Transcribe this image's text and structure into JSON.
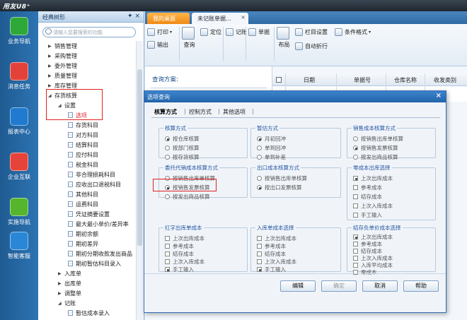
{
  "titlebar": {
    "logo": "用友U8⁺"
  },
  "iconbar": [
    {
      "label": "业务导航",
      "color": "#2fa83a"
    },
    {
      "label": "消息任务",
      "color": "#e3423a"
    },
    {
      "label": "报表中心",
      "color": "#1f7ad0"
    },
    {
      "label": "企业互联",
      "color": "#e6443a"
    },
    {
      "label": "实施导航",
      "color": "#55b52c"
    },
    {
      "label": "智能客服",
      "color": "#2a86d6"
    }
  ],
  "tree_panel": {
    "title": "经典树形",
    "pins": "✦ ×",
    "search_placeholder": "请输入您要搜索的功能",
    "items": [
      {
        "label": "销售管理"
      },
      {
        "label": "采购管理"
      },
      {
        "label": "委外管理"
      },
      {
        "label": "质量管理"
      },
      {
        "label": "库存管理"
      },
      {
        "label": "存货核算"
      },
      {
        "label": "设置"
      },
      {
        "label": "选项"
      },
      {
        "label": "存货科目"
      },
      {
        "label": "对方科目"
      },
      {
        "label": "结算科目"
      },
      {
        "label": "应付科目"
      },
      {
        "label": "税金科目"
      },
      {
        "label": "非合理损耗科目"
      },
      {
        "label": "应收出口退税科目"
      },
      {
        "label": "其他科目"
      },
      {
        "label": "运费科目"
      },
      {
        "label": "凭证摘要设置"
      },
      {
        "label": "最大最小单价/差异率"
      },
      {
        "label": "期初余额"
      },
      {
        "label": "期初差异"
      },
      {
        "label": "期初分期收款发出商品"
      },
      {
        "label": "期初暂估科目录入"
      },
      {
        "label": "入库单"
      },
      {
        "label": "出库单"
      },
      {
        "label": "调整单"
      },
      {
        "label": "记账"
      },
      {
        "label": "暂估成本录入"
      }
    ]
  },
  "tabs": {
    "home": "我的桌面",
    "active": "未记账单据…"
  },
  "toolbar": {
    "print": "打印",
    "output": "输出",
    "query": "查询",
    "locate": "定位",
    "record": "记账",
    "doc": "单据",
    "layout": "布局",
    "column": "栏目设置",
    "cond_format": "条件格式",
    "auto_fold": "自动折行"
  },
  "query_panel": {
    "label": "查询方案:"
  },
  "grid": {
    "headers": [
      "日期",
      "单据号",
      "仓库名称",
      "收发类别"
    ]
  },
  "dialog": {
    "title": "选项查询",
    "tabs": [
      "核算方式",
      "控制方式",
      "其他选项"
    ],
    "groups": {
      "hesuan": {
        "title": "核算方式",
        "options": [
          {
            "label": "按仓库核算",
            "on": true
          },
          {
            "label": "按部门核算",
            "on": false
          },
          {
            "label": "按存货核算",
            "on": false
          }
        ]
      },
      "zangu": {
        "title": "暂估方式",
        "options": [
          {
            "label": "月初回冲",
            "on": true
          },
          {
            "label": "单到回冲",
            "on": false
          },
          {
            "label": "单到补差",
            "on": false
          }
        ]
      },
      "xiaoshou": {
        "title": "销售成本核算方式",
        "options": [
          {
            "label": "按销售出库单核算",
            "on": false
          },
          {
            "label": "按销售发票核算",
            "on": true
          },
          {
            "label": "按发出商品核算",
            "on": false
          }
        ]
      },
      "weituo": {
        "title": "委托代销成本核算方式",
        "options": [
          {
            "label": "按销售出库单核算",
            "on": false
          },
          {
            "label": "按销售发票核算",
            "on": true
          },
          {
            "label": "按发出商品核算",
            "on": false
          }
        ]
      },
      "chukou": {
        "title": "出口成本核算方式",
        "options": [
          {
            "label": "按销售出库单核算",
            "on": false
          },
          {
            "label": "按出口发票核算",
            "on": true
          }
        ]
      },
      "linggou": {
        "title": "零成本出库选择",
        "options": [
          {
            "label": "上次出库成本",
            "on": true
          },
          {
            "label": "参考成本",
            "on": false
          },
          {
            "label": "结存成本",
            "on": false
          },
          {
            "label": "上次入库成本",
            "on": false
          },
          {
            "label": "手工输入",
            "on": false
          }
        ]
      },
      "hongzi": {
        "title": "红字出库单成本",
        "options": [
          {
            "label": "上次出库成本",
            "on": false
          },
          {
            "label": "参考成本",
            "on": false
          },
          {
            "label": "结存成本",
            "on": false
          },
          {
            "label": "上次入库成本",
            "on": false
          },
          {
            "label": "手工输入",
            "on": true
          }
        ]
      },
      "ruku": {
        "title": "入库单成本选择",
        "options": [
          {
            "label": "上次出库成本",
            "on": false
          },
          {
            "label": "参考成本",
            "on": false
          },
          {
            "label": "结存成本",
            "on": false
          },
          {
            "label": "上次入库成本",
            "on": false
          },
          {
            "label": "手工输入",
            "on": true
          }
        ]
      },
      "jiecun": {
        "title": "结存负单价成本选择",
        "options": [
          {
            "label": "上次出库成本",
            "on": true
          },
          {
            "label": "参考成本",
            "on": false
          },
          {
            "label": "结存成本",
            "on": false
          },
          {
            "label": "上次入库成本",
            "on": false
          },
          {
            "label": "入库平均成本",
            "on": false
          },
          {
            "label": "零成本",
            "on": false
          }
        ]
      }
    },
    "buttons": {
      "edit": "编辑",
      "ok": "确定",
      "cancel": "取消",
      "help": "帮助"
    }
  }
}
